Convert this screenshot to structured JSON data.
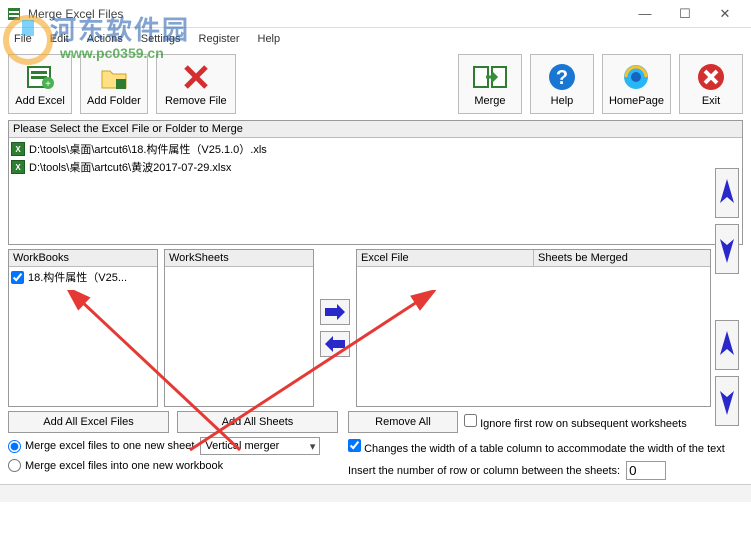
{
  "window": {
    "title": "Merge Excel Files"
  },
  "menu": {
    "file": "File",
    "edit": "Edit",
    "actions": "Actions",
    "settings": "Settings",
    "register": "Register",
    "help": "Help"
  },
  "toolbar": {
    "add_excel": "Add Excel",
    "add_folder": "Add Folder",
    "remove_file": "Remove File",
    "merge": "Merge",
    "help": "Help",
    "homepage": "HomePage",
    "exit": "Exit"
  },
  "filelist": {
    "header": "Please Select the Excel File or Folder to Merge",
    "items": [
      "D:\\tools\\桌面\\artcut6\\18.构件属性（V25.1.0）.xls",
      "D:\\tools\\桌面\\artcut6\\黄波2017-07-29.xlsx"
    ]
  },
  "panels": {
    "workbooks_hdr": "WorkBooks",
    "worksheets_hdr": "WorkSheets",
    "excelfile_hdr": "Excel File",
    "sheetsmerged_hdr": "Sheets be Merged",
    "workbooks": [
      {
        "checked": true,
        "label": "18.构件属性（V25..."
      }
    ]
  },
  "buttons": {
    "add_all_excel": "Add All Excel Files",
    "add_all_sheets": "Add All Sheets",
    "remove_all": "Remove All"
  },
  "options": {
    "radio_one_sheet": "Merge excel files to one new sheet",
    "radio_one_workbook": "Merge excel files into one new workbook",
    "merger_type": "Vertical merger",
    "ignore_first_row": "Ignore first row on subsequent worksheets",
    "change_width": "Changes the width of a table column to accommodate the width of the text",
    "insert_number_label": "Insert the number of row or column between the sheets:",
    "insert_number_value": "0"
  },
  "watermark": {
    "text": "河东软件园",
    "url": "www.pc0359.cn"
  }
}
